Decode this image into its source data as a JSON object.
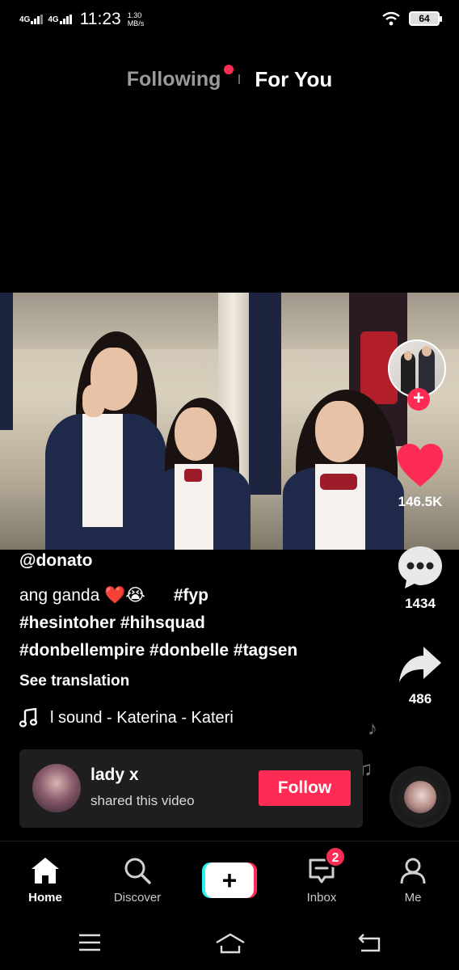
{
  "status_bar": {
    "network_1": "4G",
    "network_2": "4G",
    "time": "11:23",
    "speed_value": "1.30",
    "speed_unit": "MB/s",
    "battery": "64"
  },
  "top_tabs": {
    "following": "Following",
    "for_you": "For You"
  },
  "side_actions": {
    "like_count": "146.5K",
    "comment_count": "1434",
    "share_count": "486"
  },
  "caption": {
    "username": "@donato",
    "text": "ang ganda ❤️😭",
    "tag_fyp": "#fyp",
    "line2": "#hesintoher #hihsquad",
    "line3": "#donbellempire #donbelle #tagsen",
    "see_translation": "See translation"
  },
  "sound": {
    "text": "l sound - Katerina - Kateri"
  },
  "shared_card": {
    "name": "lady x",
    "subtitle": "shared this video",
    "follow_label": "Follow"
  },
  "bottom_nav": {
    "home": "Home",
    "discover": "Discover",
    "inbox": "Inbox",
    "inbox_badge": "2",
    "me": "Me"
  },
  "colors": {
    "accent": "#fe2c55",
    "cyan": "#25f4ee",
    "background": "#000000",
    "card": "#1e1e1e"
  },
  "icons": [
    "wifi-icon",
    "battery-icon",
    "heart-icon",
    "comment-icon",
    "share-icon",
    "music-note-icon",
    "home-icon",
    "search-icon",
    "plus-icon",
    "inbox-icon",
    "profile-icon",
    "menu-icon",
    "home-outline-icon",
    "back-icon"
  ]
}
